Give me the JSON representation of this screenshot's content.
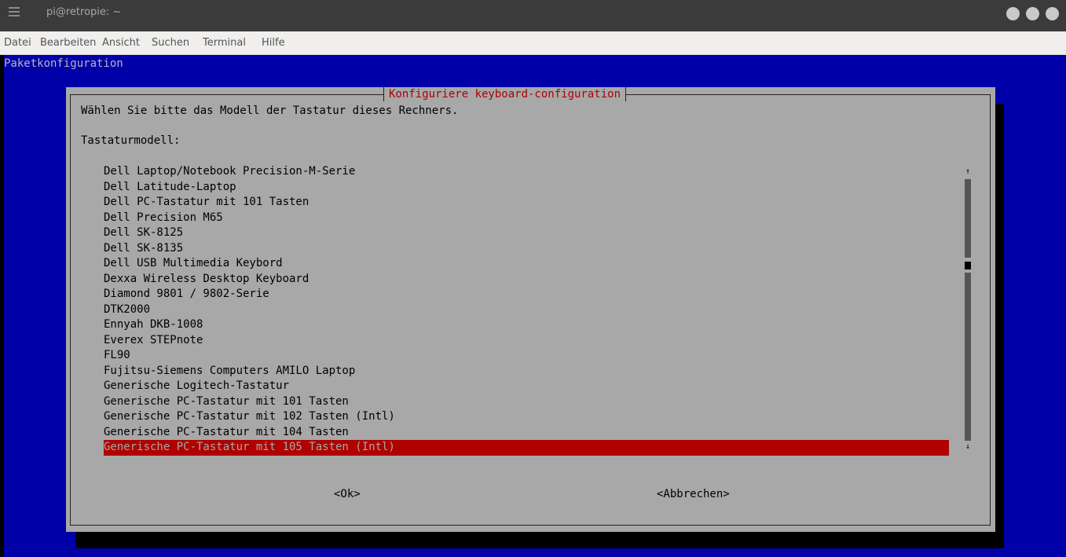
{
  "window": {
    "title": "pi@retropie: ~",
    "button_colors": [
      "#c9c9c9",
      "#c9c9c9",
      "#c9c9c9"
    ]
  },
  "menu": {
    "items": [
      "Datei",
      "Bearbeiten",
      "Ansicht",
      "Suchen",
      "Terminal",
      "Hilfe"
    ]
  },
  "terminal": {
    "header": "Paketkonfiguration",
    "background": "#0000a8"
  },
  "dialog": {
    "title": "Konfiguriere keyboard-configuration",
    "prompt": "Wählen Sie bitte das Modell der Tastatur dieses Rechners.",
    "label": "Tastaturmodell:",
    "items": [
      "Dell Laptop/Notebook Precision-M-Serie",
      "Dell Latitude-Laptop",
      "Dell PC-Tastatur mit 101 Tasten",
      "Dell Precision M65",
      "Dell SK-8125",
      "Dell SK-8135",
      "Dell USB Multimedia Keybord",
      "Dexxa Wireless Desktop Keyboard",
      "Diamond 9801 / 9802-Serie",
      "DTK2000",
      "Ennyah DKB-1008",
      "Everex STEPnote",
      "FL90",
      "Fujitsu-Siemens Computers AMILO Laptop",
      "Generische Logitech-Tastatur",
      "Generische PC-Tastatur mit 101 Tasten",
      "Generische PC-Tastatur mit 102 Tasten (Intl)",
      "Generische PC-Tastatur mit 104 Tasten",
      "Generische PC-Tastatur mit 105 Tasten (Intl)"
    ],
    "selected_index": 18,
    "selected_color": "#b00000",
    "scroll_up_icon": "↑",
    "scroll_down_icon": "↓",
    "ok_label": "<Ok>",
    "cancel_label": "<Abbrechen>"
  }
}
